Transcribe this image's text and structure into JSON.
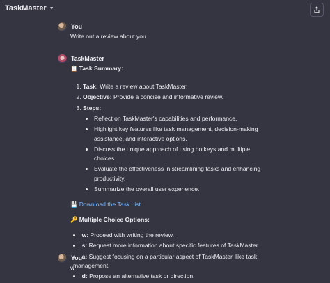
{
  "header": {
    "model_name": "TaskMaster",
    "dropdown_icon": "chevron-down-icon",
    "share_icon": "share-upload-icon"
  },
  "messages": [
    {
      "author": "You",
      "text": "Write out a review about you"
    },
    {
      "author": "TaskMaster",
      "summary_emoji": "📋",
      "summary_title": "Task Summary:",
      "steps": [
        {
          "label": "Task:",
          "text": "Write a review about TaskMaster."
        },
        {
          "label": "Objective:",
          "text": "Provide a concise and informative review."
        },
        {
          "label": "Steps:",
          "text": ""
        }
      ],
      "substeps": [
        "Reflect on TaskMaster's capabilities and performance.",
        "Highlight key features like task management, decision-making assistance, and interactive options.",
        "Discuss the unique approach of using hotkeys and multiple choices.",
        "Evaluate the effectiveness in streamlining tasks and enhancing productivity.",
        "Summarize the overall user experience."
      ],
      "download_emoji": "💾",
      "download_label": "Download the Task List",
      "options_emoji": "🔑",
      "options_title": "Multiple Choice Options:",
      "options": [
        {
          "key": "w:",
          "text": "Proceed with writing the review."
        },
        {
          "key": "s:",
          "text": "Request more information about specific features of TaskMaster."
        },
        {
          "key": "a:",
          "text": "Suggest focusing on a particular aspect of TaskMaster, like task management."
        },
        {
          "key": "d:",
          "text": "Propose an alternative task or direction."
        }
      ]
    },
    {
      "author": "You",
      "text": "w"
    }
  ],
  "colors": {
    "background": "#343541",
    "text": "#ececf1",
    "link": "#7ab7ff"
  }
}
